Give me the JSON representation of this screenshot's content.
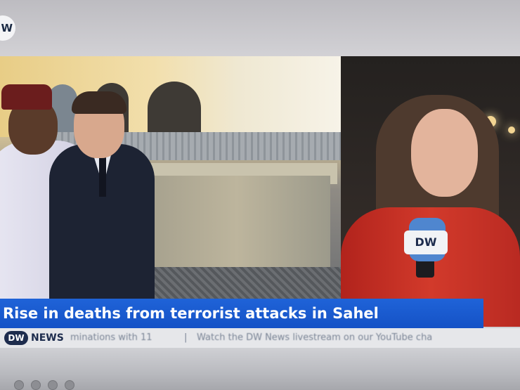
{
  "corner_logo": {
    "text": "W"
  },
  "headline": {
    "text": "Rise in deaths from terrorist attacks in Sahel"
  },
  "ticker": {
    "logo": "DW",
    "channel": "NEWS",
    "item1": "minations with 11",
    "separator": "|",
    "item2": "Watch the DW News livestream on our YouTube cha"
  },
  "mic_flag": {
    "text": "DW"
  },
  "colors": {
    "headline_bg": "#1f63d8",
    "ticker_bg": "#e6e7ea",
    "dw_navy": "#1d2c4d",
    "jacket_red": "#d23a2b"
  }
}
